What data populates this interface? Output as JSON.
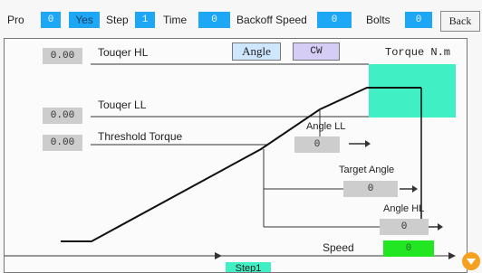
{
  "topbar": {
    "pro_label": "Pro",
    "pro_value": "0",
    "yes_label": "Yes",
    "step_label": "Step",
    "step_value": "1",
    "time_label": "Time",
    "time_value": "0",
    "backoff_label": "Backoff Speed",
    "backoff_value": "0",
    "bolts_label": "Bolts",
    "bolts_value": "0",
    "back_label": "Back"
  },
  "panel": {
    "torque_hl_value": "0.00",
    "torque_hl_label": "Touqer HL",
    "angle_button": "Angle",
    "direction_button": "CW",
    "axis_label": "Torque N.m",
    "torque_ll_value": "0.00",
    "torque_ll_label": "Touqer LL",
    "threshold_value": "0.00",
    "threshold_label": "Threshold Torque",
    "angle_ll_label": "Angle LL",
    "angle_ll_value": "0",
    "target_angle_label": "Target Angle",
    "target_angle_value": "0",
    "angle_hl_label": "Angle HL",
    "angle_hl_value": "0",
    "speed_label": "Speed",
    "speed_value": "0",
    "step_tag": "Step1"
  },
  "colors": {
    "field_blue": "#1ea7f4",
    "zone_green": "#40f0c4",
    "speed_green": "#22e622",
    "chip_blue": "#cfe6ff",
    "chip_purple": "#d6cdf7",
    "warn_orange": "#f5a020"
  }
}
